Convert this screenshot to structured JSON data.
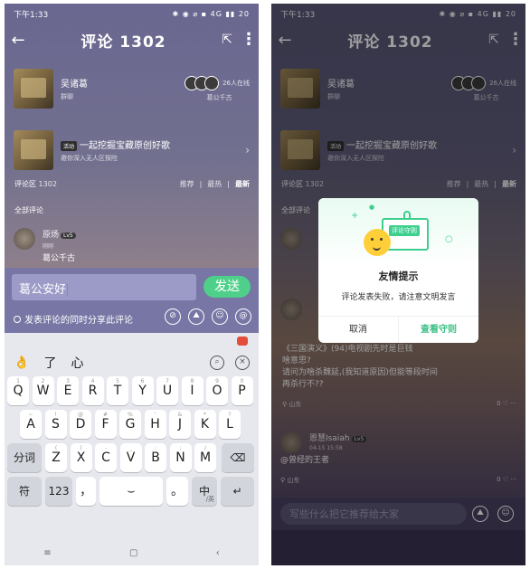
{
  "status": {
    "time": "下午1:33",
    "icons": "✱ ◉ ⌀ ▪ 4G ▮▮ 20"
  },
  "header": {
    "title": "评论 1302"
  },
  "group": {
    "name": "吴诸葛",
    "sub": "群聊",
    "online": "26人在线",
    "online_sub": "葛公千古"
  },
  "album": {
    "tag": "活动",
    "title": "一起挖掘宝藏原创好歌",
    "sub": "邀你深入无人区探险"
  },
  "section": {
    "label": "评论区",
    "count": "1302",
    "sort_recommend": "推荐",
    "sort_hot": "最热",
    "sort_new": "最新",
    "all": "全部评论"
  },
  "left_comment": {
    "user": "原炀",
    "level": "Lv5",
    "date": "刚刚",
    "text": "葛公千古"
  },
  "compose": {
    "input_value": "葛公安好",
    "send": "发送",
    "share": "发表评论的同时分享此评论"
  },
  "keyboard": {
    "candidates": [
      "👌",
      "了",
      "心"
    ],
    "row1": [
      {
        "m": "Q",
        "s": "1"
      },
      {
        "m": "W",
        "s": "2"
      },
      {
        "m": "E",
        "s": "3"
      },
      {
        "m": "R",
        "s": "4"
      },
      {
        "m": "T",
        "s": "5"
      },
      {
        "m": "Y",
        "s": "6"
      },
      {
        "m": "U",
        "s": "7"
      },
      {
        "m": "I",
        "s": "8"
      },
      {
        "m": "O",
        "s": "9"
      },
      {
        "m": "P",
        "s": "0"
      }
    ],
    "row2": [
      {
        "m": "A",
        "s": "~"
      },
      {
        "m": "S",
        "s": "!"
      },
      {
        "m": "D",
        "s": "@"
      },
      {
        "m": "F",
        "s": "#"
      },
      {
        "m": "G",
        "s": "%"
      },
      {
        "m": "H",
        "s": "'"
      },
      {
        "m": "J",
        "s": "&"
      },
      {
        "m": "K",
        "s": "*"
      },
      {
        "m": "L",
        "s": "?"
      }
    ],
    "row3": [
      {
        "m": "Z",
        "s": "("
      },
      {
        "m": "X",
        "s": ")"
      },
      {
        "m": "C",
        "s": "-"
      },
      {
        "m": "V",
        "s": "_"
      },
      {
        "m": "B",
        "s": ":"
      },
      {
        "m": "N",
        "s": ";"
      },
      {
        "m": "M",
        "s": "/"
      }
    ],
    "fn_segment": "分词",
    "fn_symbol": "符",
    "fn_123": "123",
    "fn_comma": "，",
    "fn_period": "。",
    "fn_lang": "中",
    "fn_lang_sub": "/英"
  },
  "dialog": {
    "badge": "评论守则",
    "title": "友情提示",
    "message": "评论发表失败，请注意文明发言",
    "cancel": "取消",
    "ok": "查看守则"
  },
  "right_comment1": {
    "text_l1": "《三国演义》(94)电视剧先时是巨钱",
    "text_l2": "啥意思?",
    "text_l3": "请问为啥杀魏延,(我知道原因)但能等段时间",
    "text_l4": "再杀行不??",
    "loc": "山东",
    "likes": "0"
  },
  "right_comment2": {
    "user": "恩慧Isaiah",
    "level": "Lv5",
    "date": "04-15 15:58",
    "text": "@曾经的王者",
    "loc": "山东",
    "likes": "0"
  },
  "right_input": {
    "placeholder": "写些什么把它推荐给大家"
  }
}
